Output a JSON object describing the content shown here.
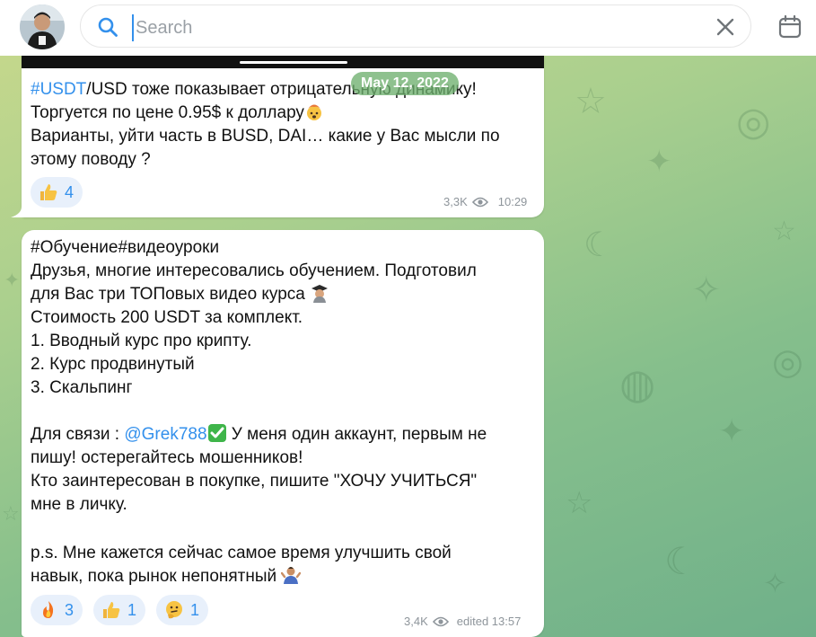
{
  "search": {
    "placeholder": "Search"
  },
  "date_pill": "May 12, 2022",
  "message_1": {
    "hashtag": "#USDT",
    "line1_rest": "/USD тоже показывает отрицательную динамику!",
    "line2": "Торгуется по цене 0.95$ к доллару",
    "line3": "Варианты, уйти часть в BUSD, DAI… какие у Вас мысли по",
    "line4": "этому поводу ?",
    "reaction": {
      "icon": "thumbs-up-emoji",
      "count": "4"
    },
    "views": "3,3K",
    "time": "10:29"
  },
  "message_2": {
    "line1": "#Обучение#видеоуроки",
    "line2": "Друзья, многие интересовались обучением. Подготовил",
    "line3": "для Вас три ТОПовых видео курса",
    "line4": "Стоимость 200 USDT за комплект.",
    "line5": "1. Вводный курс про крипту.",
    "line6": "2. Курс продвинутый",
    "line7": "3. Скальпинг",
    "line8_prefix": "Для связи : ",
    "mention": "@Grek788",
    "line8_suffix": " У меня один аккаунт, первым не",
    "line9": "пишу! остерегайтесь мошенников!",
    "line10": "Кто заинтересован в покупке, пишите \"ХОЧУ УЧИТЬСЯ\"",
    "line11": "мне в личку.",
    "line12": "p.s. Мне кажется сейчас самое время улучшить свой",
    "line13": "навык, пока рынок непонятный",
    "reactions": [
      {
        "icon": "fire-emoji",
        "count": "3"
      },
      {
        "icon": "thumbs-up-emoji",
        "count": "1"
      },
      {
        "icon": "thinking-face-emoji",
        "count": "1"
      }
    ],
    "views": "3,4K",
    "edited_time": "edited 13:57"
  },
  "colors": {
    "accent": "#3390ec",
    "reaction_bg": "#e8f0fb",
    "meta": "#8e959b",
    "date_pill_bg": "#6eaf6e"
  }
}
